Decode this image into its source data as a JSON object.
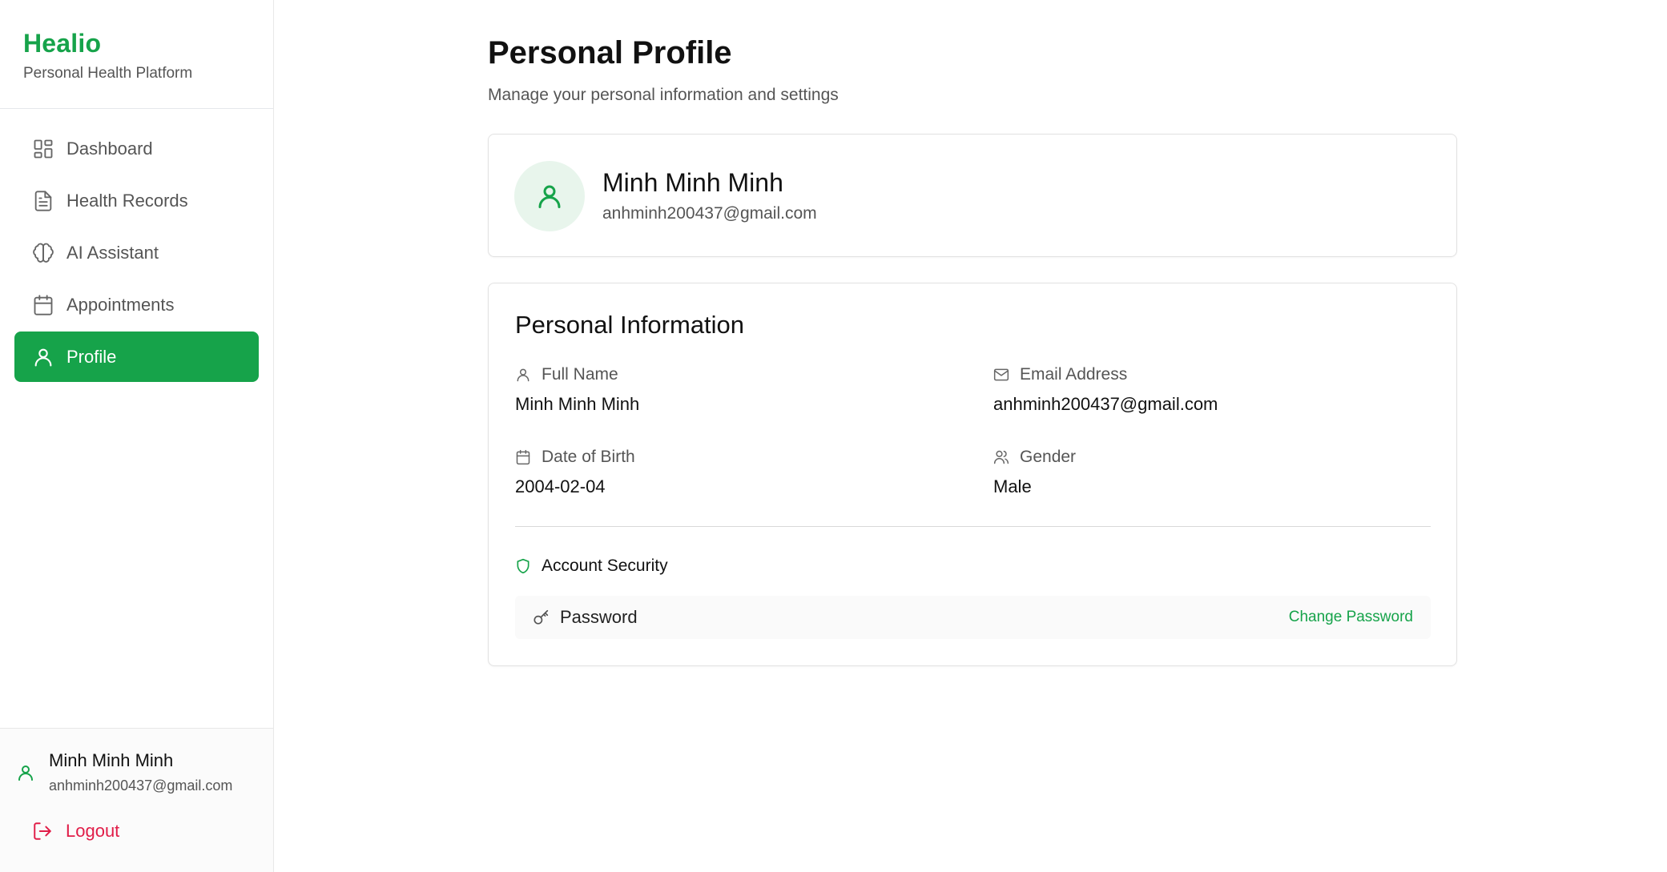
{
  "brand": {
    "name": "Healio",
    "subtitle": "Personal Health Platform"
  },
  "sidebar": {
    "items": [
      {
        "label": "Dashboard",
        "icon": "dashboard-icon",
        "active": false
      },
      {
        "label": "Health Records",
        "icon": "file-icon",
        "active": false
      },
      {
        "label": "AI Assistant",
        "icon": "brain-icon",
        "active": false
      },
      {
        "label": "Appointments",
        "icon": "calendar-icon",
        "active": false
      },
      {
        "label": "Profile",
        "icon": "user-icon",
        "active": true
      }
    ],
    "user": {
      "name": "Minh Minh Minh",
      "email": "anhminh200437@gmail.com"
    },
    "logout_label": "Logout"
  },
  "main": {
    "title": "Personal Profile",
    "subtitle": "Manage your personal information and settings",
    "profile_card": {
      "name": "Minh Minh Minh",
      "email": "anhminh200437@gmail.com"
    },
    "info": {
      "title": "Personal Information",
      "full_name": {
        "label": "Full Name",
        "value": "Minh Minh Minh"
      },
      "email": {
        "label": "Email Address",
        "value": "anhminh200437@gmail.com"
      },
      "dob": {
        "label": "Date of Birth",
        "value": "2004-02-04"
      },
      "gender": {
        "label": "Gender",
        "value": "Male"
      }
    },
    "security": {
      "title": "Account Security",
      "password_label": "Password",
      "change_password_label": "Change Password"
    }
  },
  "colors": {
    "brand": "#16a34a",
    "logout": "#e11d48",
    "avatar_bg": "#e8f5ec"
  }
}
